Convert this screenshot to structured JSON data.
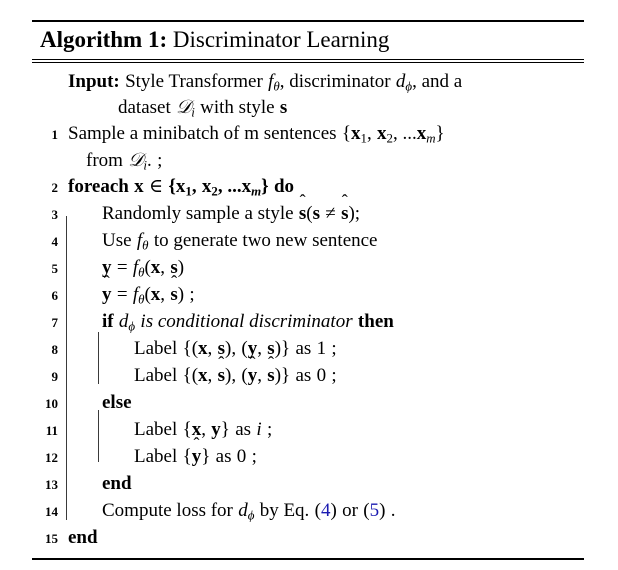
{
  "algorithm": {
    "title_prefix": "Algorithm 1:",
    "title_text": "Discriminator Learning",
    "input_label": "Input:",
    "input_line_1_a": "Style Transformer",
    "input_line_1_f": "f",
    "input_line_1_f_sub": "θ",
    "input_line_1_b": ", discriminator",
    "input_line_1_d": "d",
    "input_line_1_d_sub": "ϕ",
    "input_line_1_c": ", and a",
    "input_line_2_a": "dataset",
    "input_line_2_D": "𝒟",
    "input_line_2_D_sub": "i",
    "input_line_2_b": "with style",
    "input_line_2_s": "s",
    "lines": [
      {
        "no": "1",
        "indent": 0,
        "text": "Sample a minibatch of m sentences {x₁, x₂, ...xₘ}"
      },
      {
        "no": "",
        "indent": 0,
        "text": "from 𝒟ᵢ. ;"
      },
      {
        "no": "2",
        "indent": 0,
        "text": "foreach x ∈ {x₁, x₂, ...xₘ} do"
      },
      {
        "no": "3",
        "indent": 1,
        "text": "Randomly sample a style ŝ(s ≠ ŝ);"
      },
      {
        "no": "4",
        "indent": 1,
        "text": "Use fθ to generate two new sentence"
      },
      {
        "no": "5",
        "indent": 1,
        "text": "y = fθ(x, s)"
      },
      {
        "no": "6",
        "indent": 1,
        "text": "ŷ = fθ(x, ŝ) ;"
      },
      {
        "no": "7",
        "indent": 1,
        "text": "if dϕ is conditional discriminator then"
      },
      {
        "no": "8",
        "indent": 2,
        "text": "Label {(x, s), (y, s)} as 1 ;"
      },
      {
        "no": "9",
        "indent": 2,
        "text": "Label {(x, ŝ), (ŷ, ŝ)} as 0 ;"
      },
      {
        "no": "10",
        "indent": 1,
        "text": "else"
      },
      {
        "no": "11",
        "indent": 2,
        "text": "Label {x, y} as i ;"
      },
      {
        "no": "12",
        "indent": 2,
        "text": "Label {ŷ} as 0 ;"
      },
      {
        "no": "13",
        "indent": 1,
        "text": "end"
      },
      {
        "no": "14",
        "indent": 1,
        "text": "Compute loss for dϕ by Eq. (4) or (5) ."
      },
      {
        "no": "15",
        "indent": 0,
        "text": "end"
      }
    ],
    "keywords": {
      "foreach": "foreach",
      "do": "do",
      "if": "if",
      "then": "then",
      "else": "else",
      "end": "end"
    },
    "symbols": {
      "x": "x",
      "y": "y",
      "s": "s",
      "f": "f",
      "d": "d",
      "theta": "θ",
      "phi": "ϕ",
      "D": "𝒟",
      "in": "∈",
      "neq": "≠",
      "hat": "̂",
      "m": "m",
      "i": "i"
    },
    "line_numbers": [
      "1",
      "2",
      "3",
      "4",
      "5",
      "6",
      "7",
      "8",
      "9",
      "10",
      "11",
      "12",
      "13",
      "14",
      "15"
    ],
    "eq_refs": [
      "4",
      "5"
    ],
    "labels_values": [
      "1",
      "0",
      "i",
      "0"
    ],
    "colors": {
      "text": "#000000",
      "eqref": "#1a1ab0",
      "rule": "#000000",
      "nesting_rule": "#3a3a3a",
      "background": "#ffffff"
    },
    "body_texts": {
      "sample": "Sample a minibatch of m sentences",
      "from": "from",
      "randomly": "Randomly sample a style",
      "use": "Use",
      "to_generate": "to generate two new sentence",
      "is_cond_disc": "is conditional discriminator",
      "label": "Label",
      "as": "as",
      "compute_loss_for": "Compute loss for",
      "by_eq": "by Eq.",
      "or": "or",
      "with_style": "with style",
      "dataset": "dataset",
      "style_transformer": "Style Transformer",
      "discriminator": "discriminator",
      "and_a": ", and a",
      "period": ".",
      "semicolon": ";"
    }
  }
}
